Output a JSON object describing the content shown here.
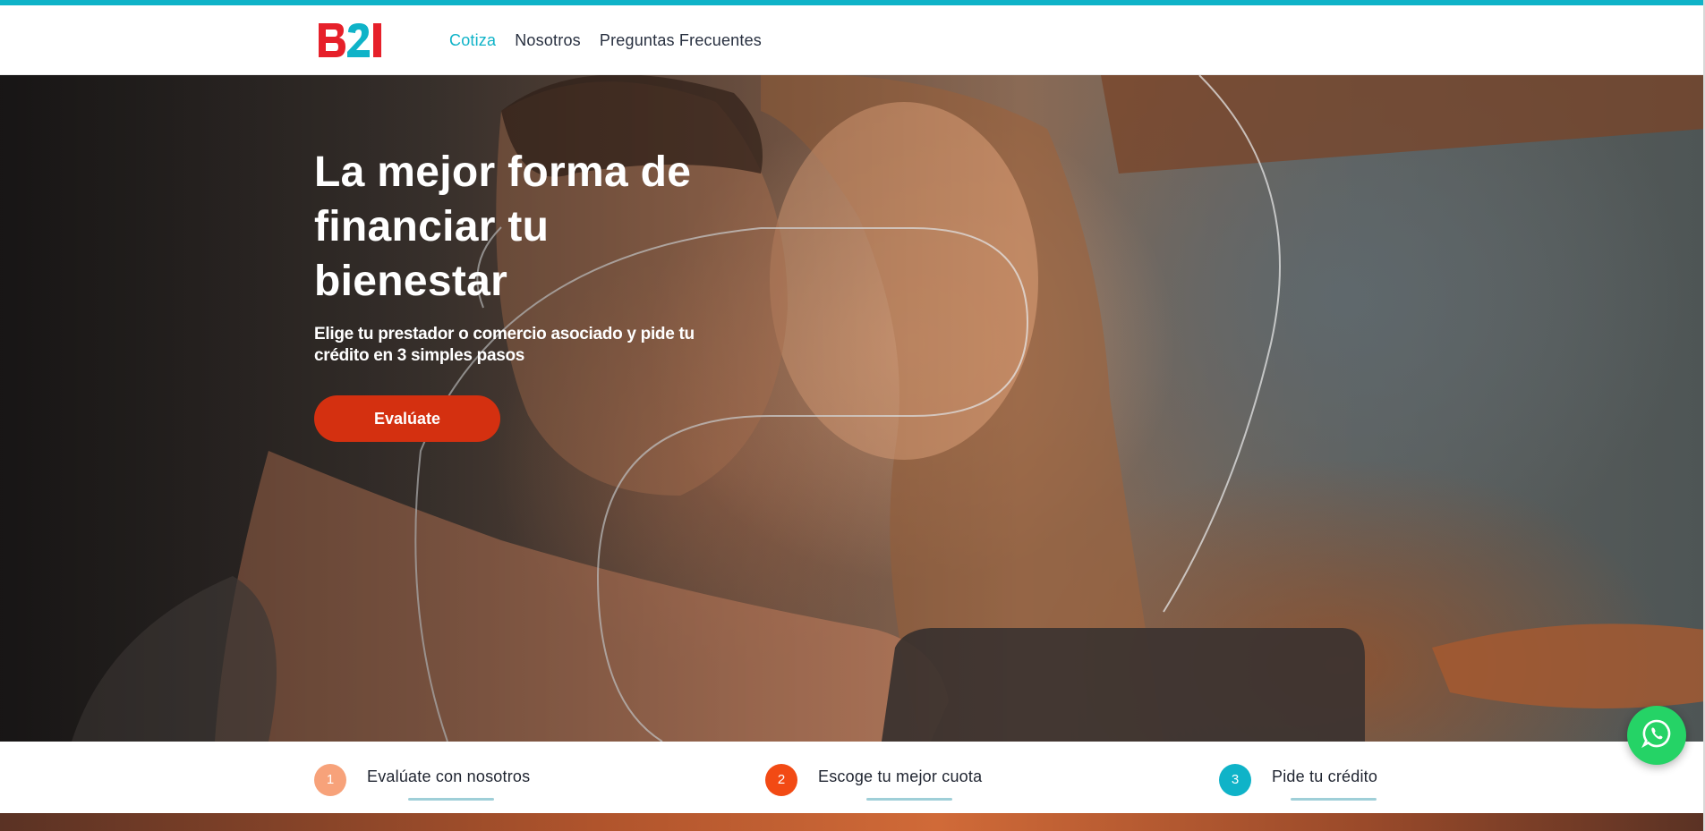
{
  "brand": {
    "logo_text": "B2I",
    "logo_colors": {
      "red": "#e6202a",
      "teal": "#0fb3c8"
    },
    "accent_color": "#0fb3c8"
  },
  "nav": {
    "items": [
      {
        "label": "Cotiza",
        "active": true
      },
      {
        "label": "Nosotros",
        "active": false
      },
      {
        "label": "Preguntas Frecuentes",
        "active": false
      }
    ]
  },
  "hero": {
    "title": "La mejor forma de financiar tu bienestar",
    "subtitle": "Elige tu prestador o comercio asociado y pide tu crédito en 3 simples pasos",
    "cta_label": "Evalúate",
    "cta_color": "#d43010",
    "background_image": "couple-embracing-looking-at-tablet"
  },
  "steps": [
    {
      "number": "1",
      "label": "Evalúate con nosotros",
      "color": "#f7a27a"
    },
    {
      "number": "2",
      "label": "Escoge tu mejor cuota",
      "color": "#f24a14"
    },
    {
      "number": "3",
      "label": "Pide tu crédito",
      "color": "#0fb3c8"
    }
  ],
  "floating": {
    "whatsapp_icon": "whatsapp-icon",
    "whatsapp_color": "#25d366"
  }
}
